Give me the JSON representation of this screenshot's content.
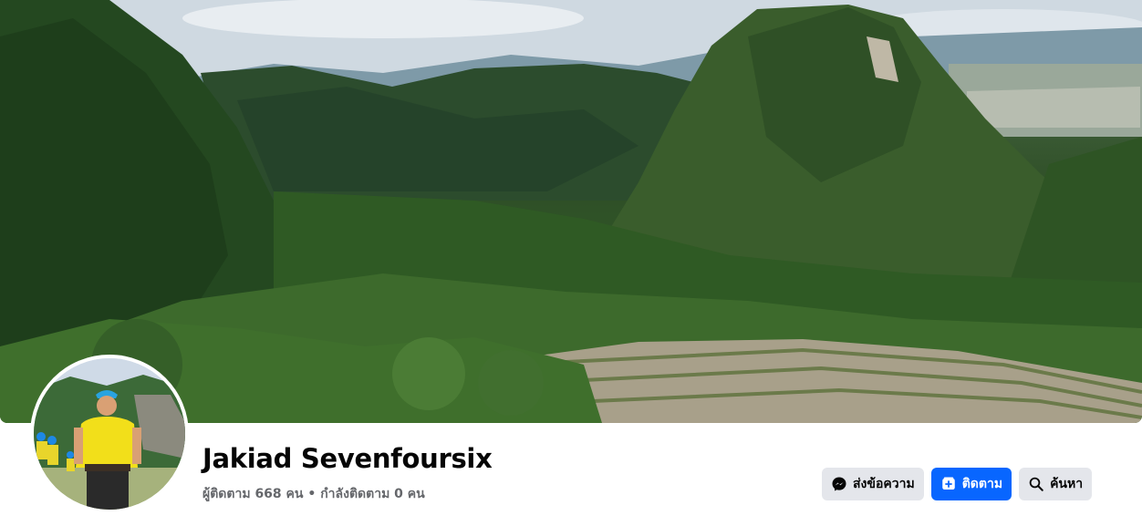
{
  "profile": {
    "name": "Jakiad Sevenfoursix",
    "followers_text": "ผู้ติดตาม 668 คน",
    "separator": "•",
    "following_text": "กำลังติดตาม 0 คน"
  },
  "actions": {
    "message_label": "ส่งข้อความ",
    "follow_label": "ติดตาม",
    "search_label": "ค้นหา"
  },
  "icons": {
    "message": "messenger-icon",
    "follow": "follow-add-icon",
    "search": "search-icon"
  },
  "colors": {
    "primary": "#0866ff",
    "secondary_button": "#e4e6eb",
    "text_primary": "#050505",
    "text_secondary": "#65676b"
  }
}
